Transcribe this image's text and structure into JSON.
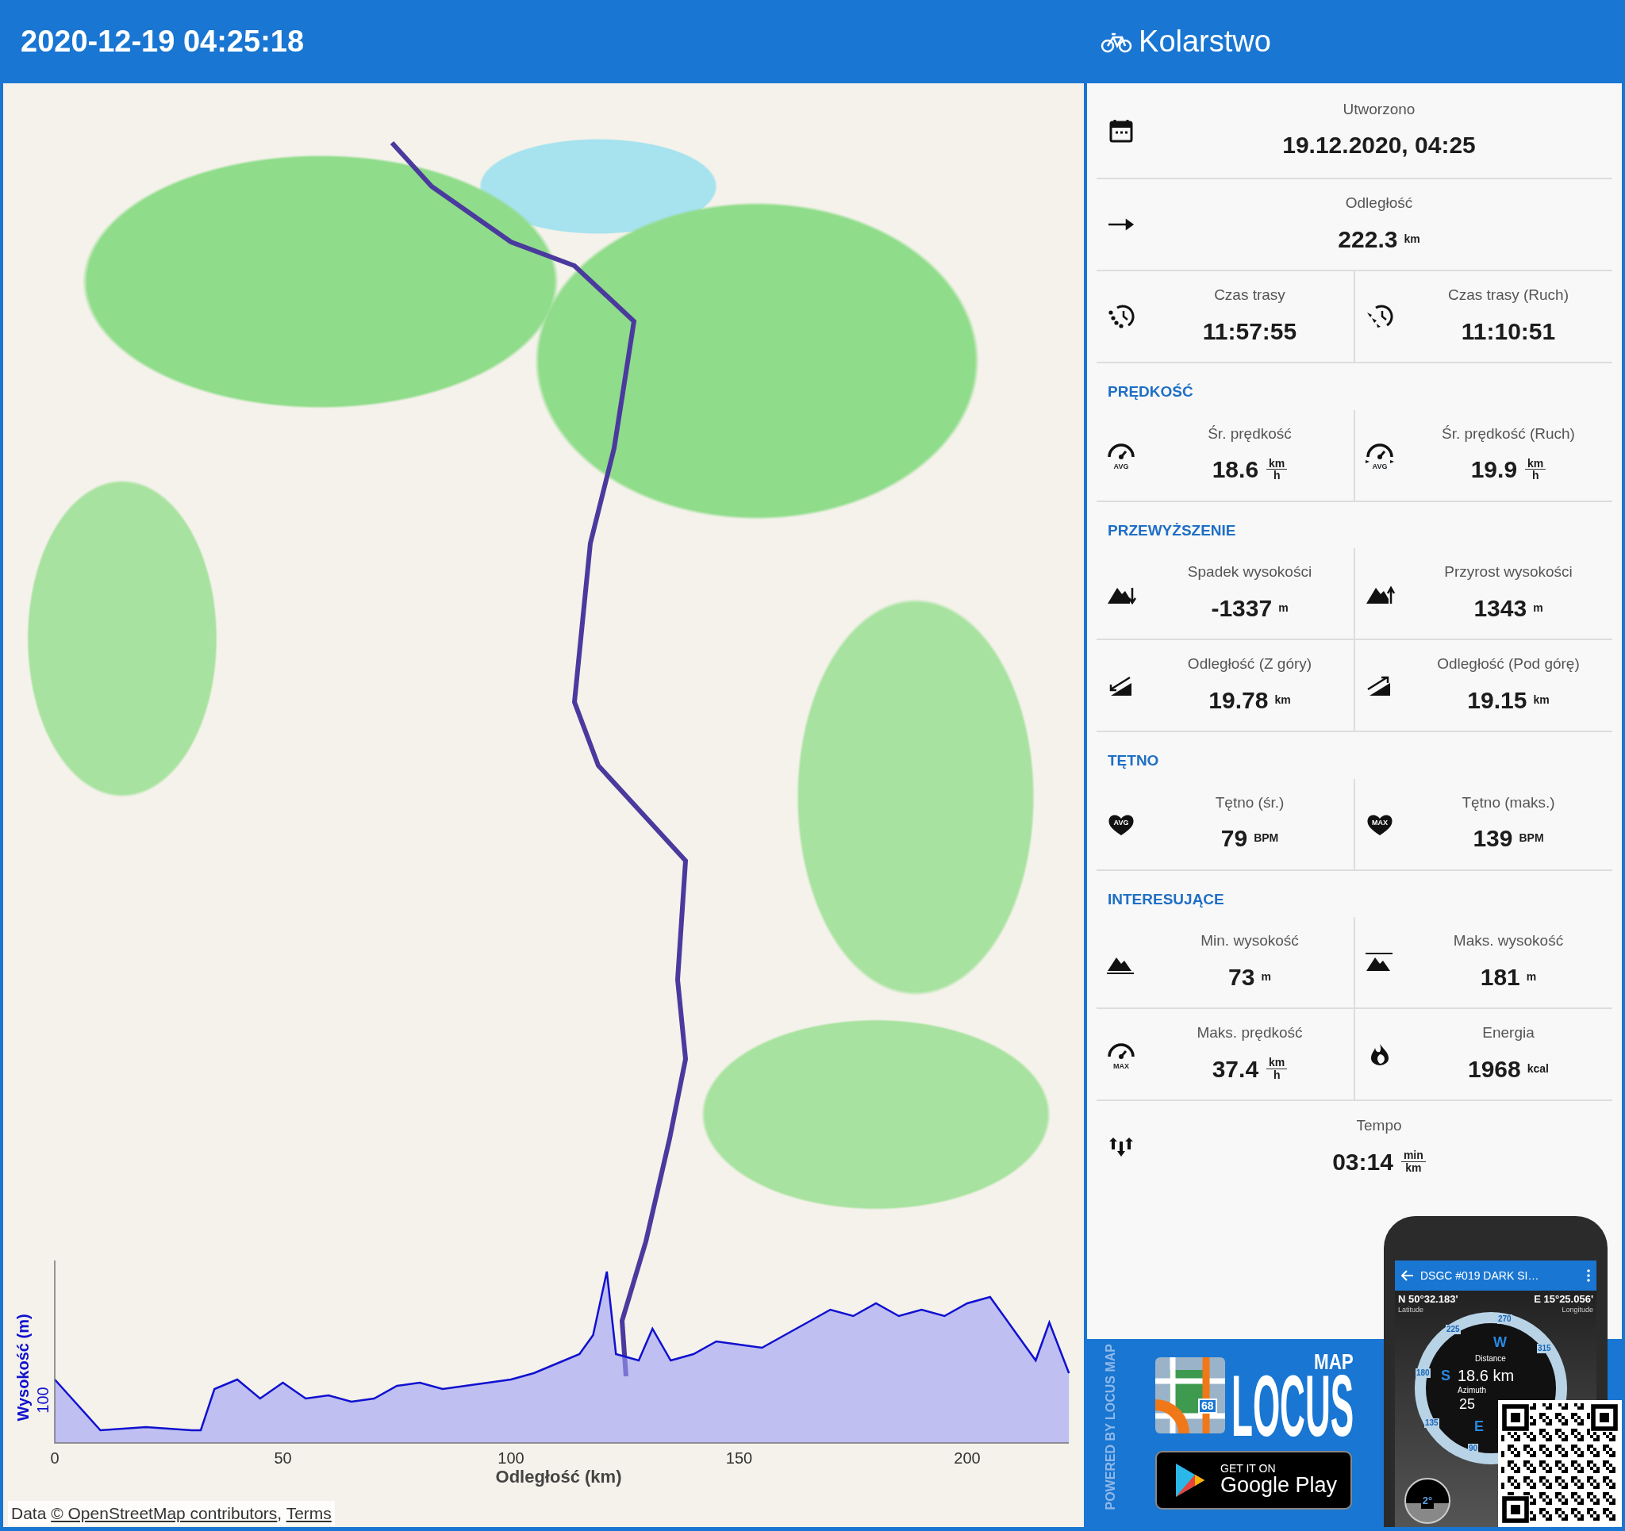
{
  "header": {
    "title": "2020-12-19 04:25:18",
    "activity": "Kolarstwo"
  },
  "map": {
    "attribution": "Data ",
    "attribution_links": [
      "© OpenStreetMap contributors",
      "Terms"
    ],
    "attribution_separator": ",",
    "elevation_profile": {
      "x_axis_label": "Odległość (km)",
      "y_axis_label": "Wysokość (m)",
      "x_tick_labels": [
        "0",
        "50",
        "100",
        "150",
        "200"
      ],
      "y_tick_label": "100"
    }
  },
  "stats": {
    "sections": [
      {
        "rows": [
          {
            "cells": [
              {
                "kind": "calendar",
                "label": "Utworzono",
                "value": "19.12.2020, 04:25"
              }
            ]
          },
          {
            "cells": [
              {
                "kind": "arrow",
                "label": "Odległość",
                "value": "222.3",
                "unit": "km"
              }
            ]
          },
          {
            "cells": [
              {
                "kind": "clock-dots",
                "label": "Czas trasy",
                "value": "11:57:55"
              },
              {
                "kind": "clock-arrows",
                "label": "Czas trasy (Ruch)",
                "value": "11:10:51"
              }
            ]
          }
        ]
      },
      {
        "heading": "PRĘDKOŚĆ",
        "rows": [
          {
            "cells": [
              {
                "kind": "gauge",
                "icon_text": "AVG",
                "label": "Śr. prędkość",
                "value": "18.6",
                "unit_fraction": [
                  "km",
                  "h"
                ]
              },
              {
                "kind": "gauge-moving",
                "icon_text": "AVG",
                "label": "Śr. prędkość (Ruch)",
                "value": "19.9",
                "unit_fraction": [
                  "km",
                  "h"
                ]
              }
            ]
          }
        ]
      },
      {
        "heading": "PRZEWYŻSZENIE",
        "rows": [
          {
            "cells": [
              {
                "kind": "mountain-down",
                "label": "Spadek wysokości",
                "value": "-1337",
                "unit": "m"
              },
              {
                "kind": "mountain-up",
                "label": "Przyrost wysokości",
                "value": "1343",
                "unit": "m"
              }
            ]
          },
          {
            "cells": [
              {
                "kind": "slope-down",
                "label": "Odległość (Z góry)",
                "value": "19.78",
                "unit": "km"
              },
              {
                "kind": "slope-up",
                "label": "Odległość (Pod górę)",
                "value": "19.15",
                "unit": "km"
              }
            ]
          }
        ]
      },
      {
        "heading": "TĘTNO",
        "rows": [
          {
            "cells": [
              {
                "kind": "heart",
                "icon_text": "AVG",
                "label": "Tętno (śr.)",
                "value": "79",
                "unit": "BPM"
              },
              {
                "kind": "heart",
                "icon_text": "MAX",
                "label": "Tętno (maks.)",
                "value": "139",
                "unit": "BPM"
              }
            ]
          }
        ]
      },
      {
        "heading": "INTERESUJĄCE",
        "rows": [
          {
            "cells": [
              {
                "kind": "mountain-low",
                "label": "Min. wysokość",
                "value": "73",
                "unit": "m"
              },
              {
                "kind": "mountain-high",
                "label": "Maks. wysokość",
                "value": "181",
                "unit": "m"
              }
            ]
          },
          {
            "cells": [
              {
                "kind": "gauge",
                "icon_text": "MAX",
                "label": "Maks. prędkość",
                "value": "37.4",
                "unit_fraction": [
                  "km",
                  "h"
                ]
              },
              {
                "kind": "flame",
                "label": "Energia",
                "value": "1968",
                "unit": "kcal"
              }
            ]
          },
          {
            "cells": [
              {
                "kind": "tempo",
                "label": "Tempo",
                "value": "03:14",
                "unit_fraction": [
                  "min",
                  "km"
                ]
              }
            ]
          }
        ]
      }
    ]
  },
  "ad": {
    "side_text": "POWERED BY LOCUS MAP",
    "logo_badge": "68",
    "logo_map": "MAP",
    "logo_name": "LOCUS",
    "store_small": "GET IT ON",
    "store_big": "Google Play",
    "phone": {
      "title": "DSGC #019 DARK SI…",
      "lat": "N 50°32.183'",
      "lat_label": "Latitude",
      "lon": "E 15°25.056'",
      "lon_label": "Longitude",
      "distance_label": "Distance",
      "distance": "18.6 km",
      "azimuth_label": "Azimuth",
      "azimuth": "25",
      "tilt": "2°",
      "compass_labels": [
        "270",
        "225",
        "315",
        "180",
        "135",
        "90",
        "W",
        "S",
        "E"
      ]
    }
  }
}
